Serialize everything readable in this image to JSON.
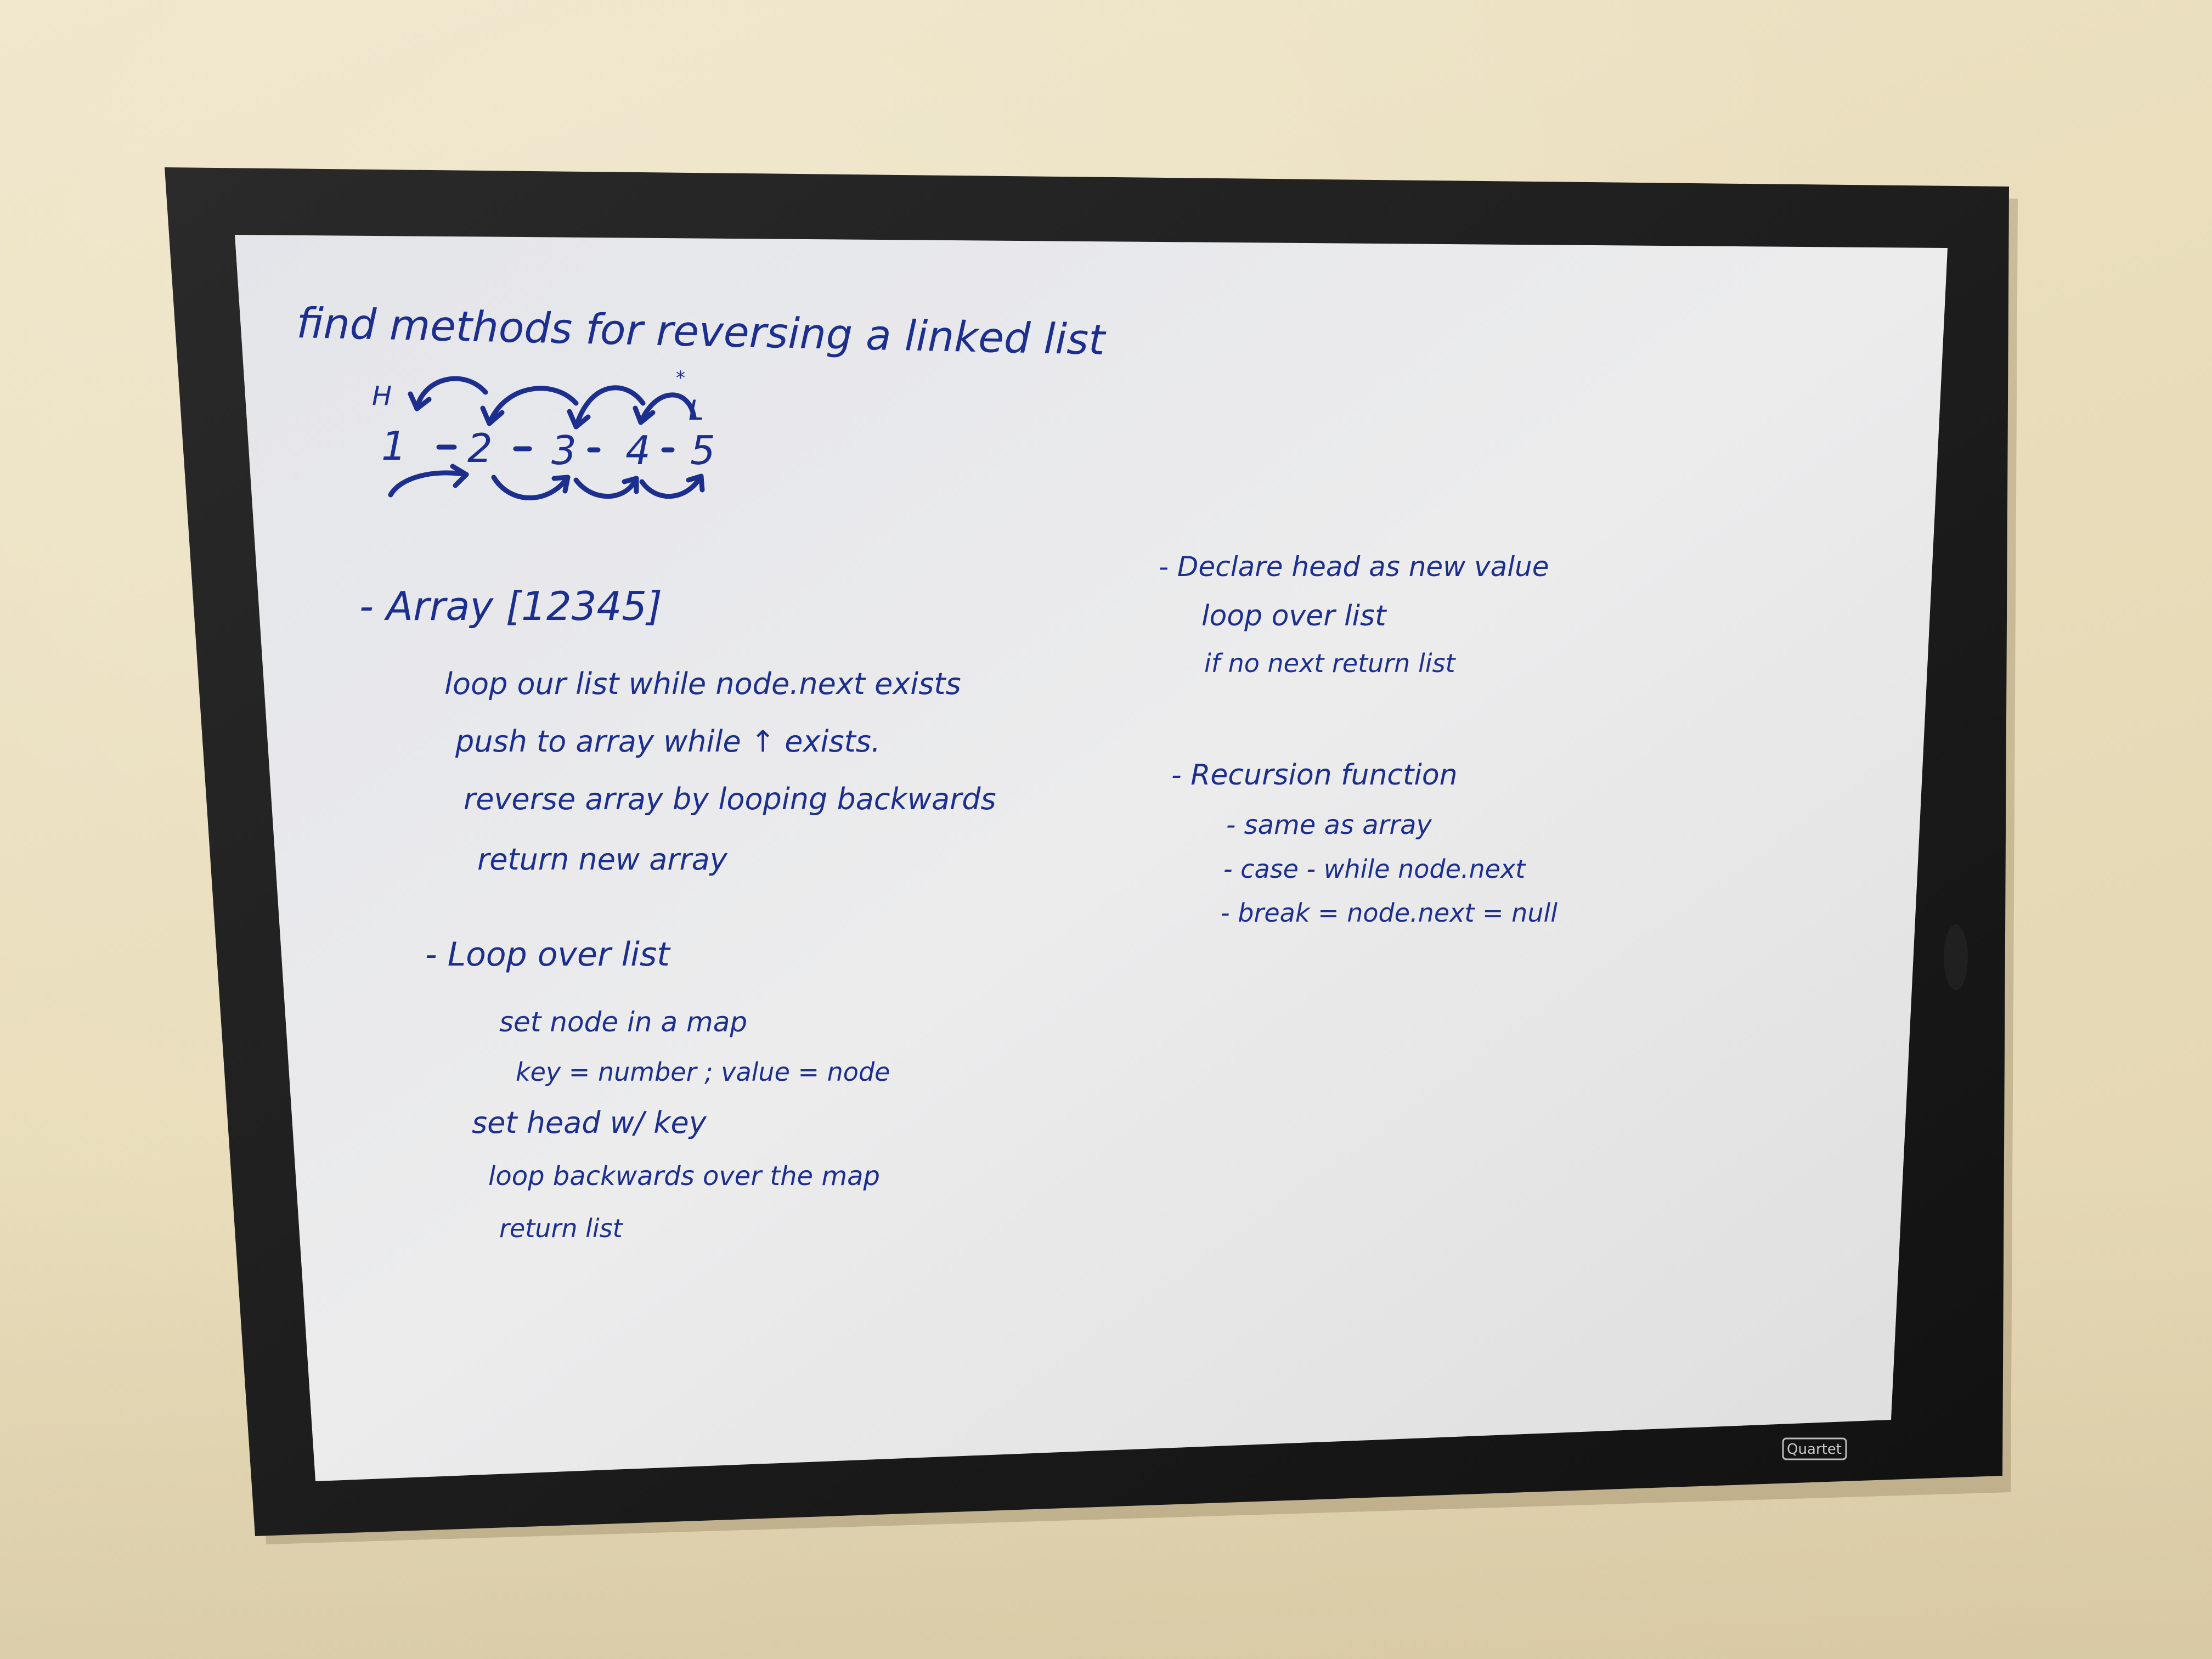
{
  "board": {
    "brand": "Quartet",
    "title": "find methods for reversing a linked list",
    "diagram": {
      "head_label": "H",
      "tail_label": "L",
      "nodes": [
        "1",
        "2",
        "3",
        "4",
        "5"
      ]
    },
    "left_column": {
      "array_heading": "- Array [12345]",
      "array_steps": [
        "loop our list while node.next exists",
        "push to array while ↑ exists.",
        "reverse array by looping backwards",
        "return new array"
      ],
      "loop_heading": "- Loop over list",
      "loop_steps": [
        "set node in a map",
        "key = number ; value = node",
        "set head w/ key",
        "loop backwards over the map",
        "return list"
      ]
    },
    "right_column": {
      "declare_heading": "- Declare head as new value",
      "declare_steps": [
        "loop over list",
        "if no next return list"
      ],
      "recursion_heading": "- Recursion function",
      "recursion_steps": [
        "- same as array",
        "- case - while node.next",
        "- break = node.next = null"
      ]
    }
  },
  "colors": {
    "wall": "#eadfbd",
    "frame": "#1a1a1a",
    "board_surface": "#e6e6e8",
    "marker_ink": "#1c2f8f"
  }
}
